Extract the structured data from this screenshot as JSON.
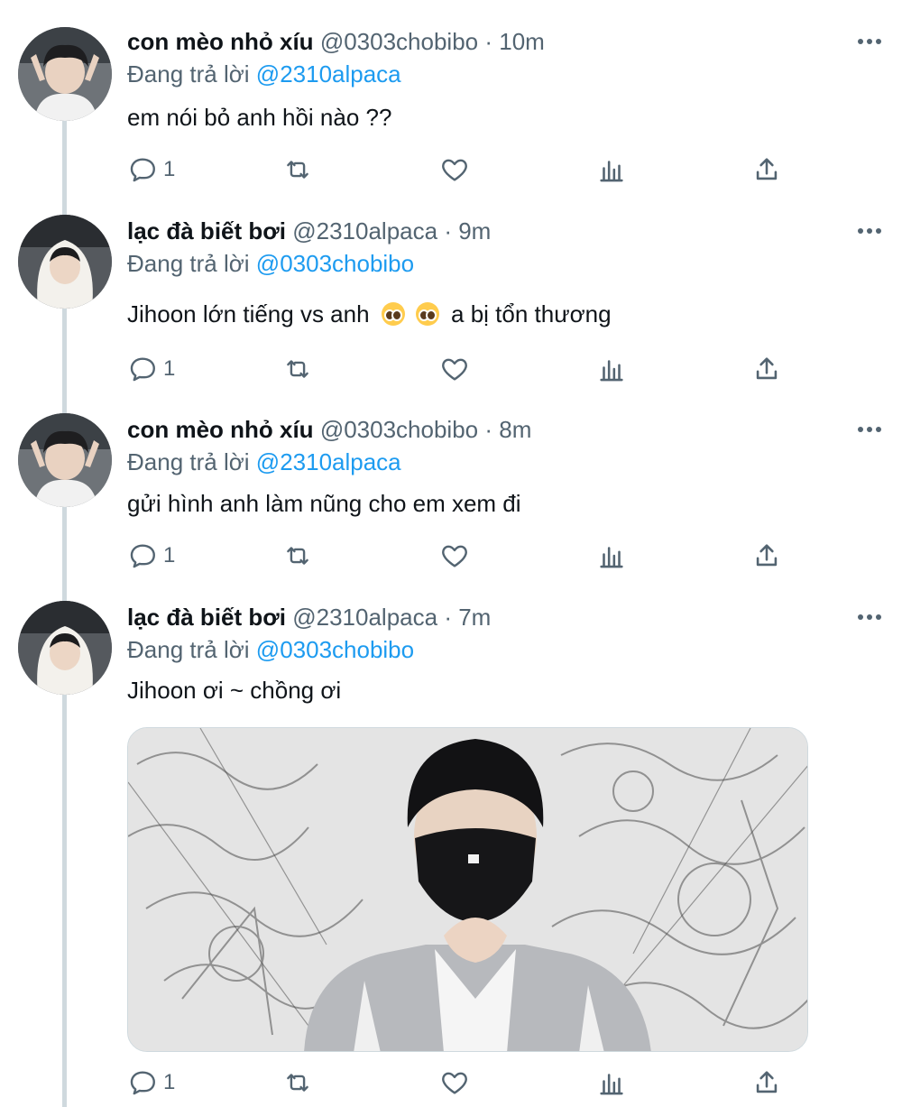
{
  "tweets": [
    {
      "name": "con mèo nhỏ xíu",
      "handle": "@0303chobibo",
      "time": "10m",
      "reply_prefix": "Đang trả lời",
      "reply_to": "@2310alpaca",
      "text": "em nói bỏ anh hồi nào ??",
      "reply_count": "1"
    },
    {
      "name": "lạc đà biết bơi",
      "handle": "@2310alpaca",
      "time": "9m",
      "reply_prefix": "Đang trả lời",
      "reply_to": "@0303chobibo",
      "text_before": "Jihoon lớn tiếng vs anh",
      "text_after": "a bị tổn thương",
      "reply_count": "1"
    },
    {
      "name": "con mèo nhỏ xíu",
      "handle": "@0303chobibo",
      "time": "8m",
      "reply_prefix": "Đang trả lời",
      "reply_to": "@2310alpaca",
      "text": "gửi hình anh làm nũng cho em xem đi",
      "reply_count": "1"
    },
    {
      "name": "lạc đà biết bơi",
      "handle": "@2310alpaca",
      "time": "7m",
      "reply_prefix": "Đang trả lời",
      "reply_to": "@0303chobibo",
      "text": "Jihoon ơi ~ chồng ơi",
      "reply_count": "1"
    }
  ],
  "separator": "·",
  "icons": {
    "reply": "reply-icon",
    "retweet": "retweet-icon",
    "like": "heart-icon",
    "stats": "stats-icon",
    "share": "share-icon",
    "more": "more-icon",
    "emoji": "pleading-face-emoji"
  },
  "colors": {
    "text": "#0f1419",
    "secondary": "#536471",
    "accent": "#1d9bf0",
    "thread_line": "#cfd9de"
  }
}
